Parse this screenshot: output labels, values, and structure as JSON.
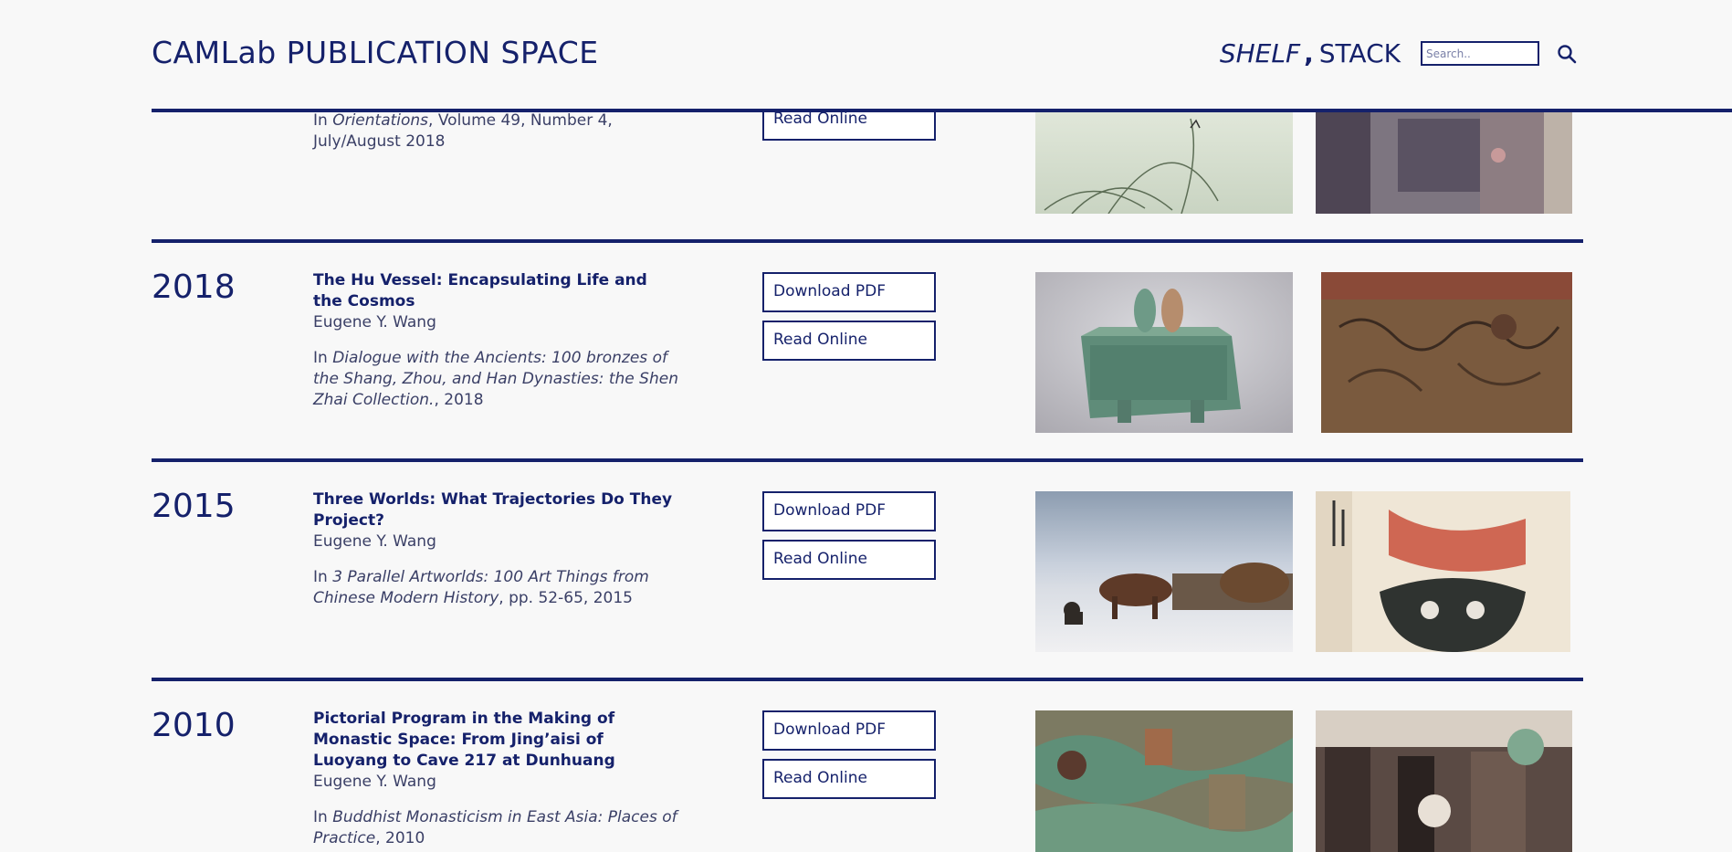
{
  "header": {
    "title": "CAMLab PUBLICATION SPACE",
    "nav_shelf": "SHELF",
    "nav_comma": ",",
    "nav_stack": "STACK",
    "search_placeholder": "Search.."
  },
  "rows": [
    {
      "year": "",
      "title": "",
      "author": "",
      "cite_prefix": "In ",
      "cite_italic": "Orientations",
      "cite_suffix": ", Volume 49, Number 4, July/August 2018",
      "download_label": "",
      "read_label": "Read Online"
    },
    {
      "year": "2018",
      "title": "The Hu Vessel: Encapsulating Life and the Cosmos",
      "author": "Eugene Y. Wang",
      "cite_prefix": "In ",
      "cite_italic": "Dialogue with the Ancients: 100 bronzes of the Shang, Zhou, and Han Dynasties: the Shen Zhai Collection.",
      "cite_suffix": ", 2018",
      "download_label": "Download PDF",
      "read_label": "Read Online"
    },
    {
      "year": "2015",
      "title": "Three Worlds: What Trajectories Do They Project?",
      "author": "Eugene Y. Wang",
      "cite_prefix": "In ",
      "cite_italic": "3 Parallel Artworlds: 100 Art Things from Chinese Modern History",
      "cite_suffix": ", pp. 52-65, 2015",
      "download_label": "Download PDF",
      "read_label": "Read Online"
    },
    {
      "year": "2010",
      "title": "Pictorial Program in the Making of Monastic Space: From Jing’aisi of Luoyang to Cave 217 at Dunhuang",
      "author": "Eugene Y. Wang",
      "cite_prefix": "In ",
      "cite_italic": "Buddhist Monasticism in East Asia: Places of Practice",
      "cite_suffix": ", 2010",
      "download_label": "Download PDF",
      "read_label": "Read Online"
    }
  ],
  "colors": {
    "accent": "#15216b",
    "background": "#f8f8f8"
  }
}
